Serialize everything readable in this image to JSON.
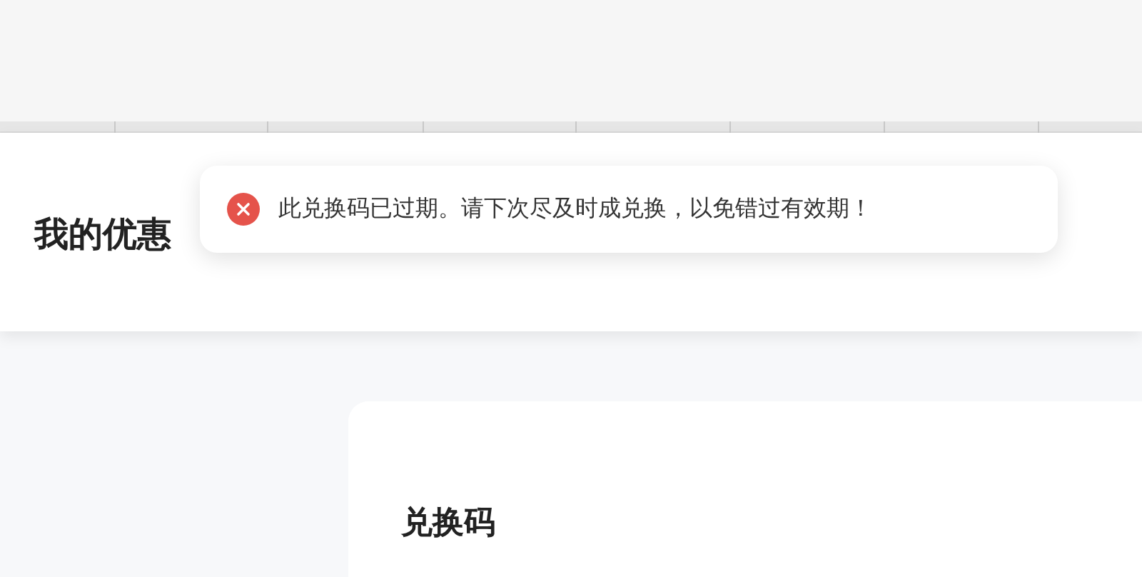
{
  "header": {
    "title": "我的优惠"
  },
  "toast": {
    "kind": "error",
    "message": "此兑换码已过期。请下次尽及时成兑换，以免错过有效期！"
  },
  "card": {
    "title": "兑换码"
  }
}
